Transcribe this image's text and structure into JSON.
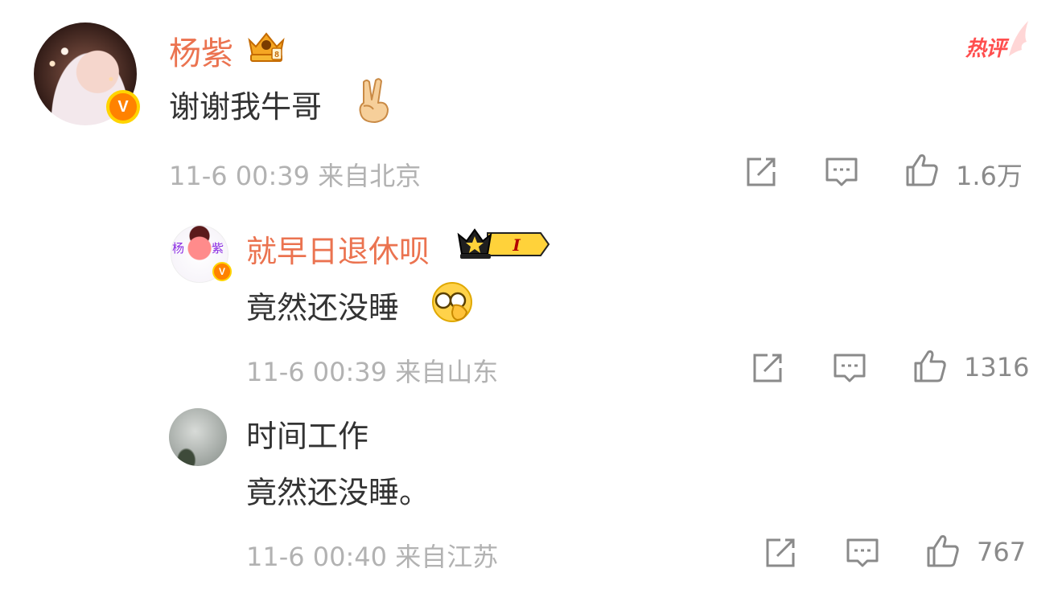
{
  "comments": [
    {
      "username": "杨紫",
      "text": "谢谢我牛哥",
      "time": "11-6 00:39",
      "location": "来自北京",
      "likes": "1.6万",
      "badge": "热评",
      "verified_mark": "V",
      "icons": [
        "crown-badge-icon",
        "peace-emoji-icon",
        "share-icon",
        "comment-icon",
        "like-icon"
      ]
    },
    {
      "username": "就早日退休呗",
      "text": "竟然还没睡",
      "time": "11-6 00:39",
      "location": "来自山东",
      "likes": "1316",
      "member_level": "I",
      "verified_mark": "V",
      "avatar_text": [
        "杨",
        "紫"
      ],
      "icons": [
        "crown-member-icon",
        "facepalm-emoji-icon",
        "share-icon",
        "comment-icon",
        "like-icon"
      ]
    },
    {
      "username": "时间工作",
      "text": "竟然还没睡。",
      "time": "11-6 00:40",
      "location": "来自江苏",
      "likes": "767",
      "icons": [
        "share-icon",
        "comment-icon",
        "like-icon"
      ]
    }
  ],
  "colors": {
    "username": "#eb7350",
    "text": "#333333",
    "meta": "#b2b2b2",
    "hot_tag": "#ff4e4e",
    "verified": "#ff8200"
  }
}
